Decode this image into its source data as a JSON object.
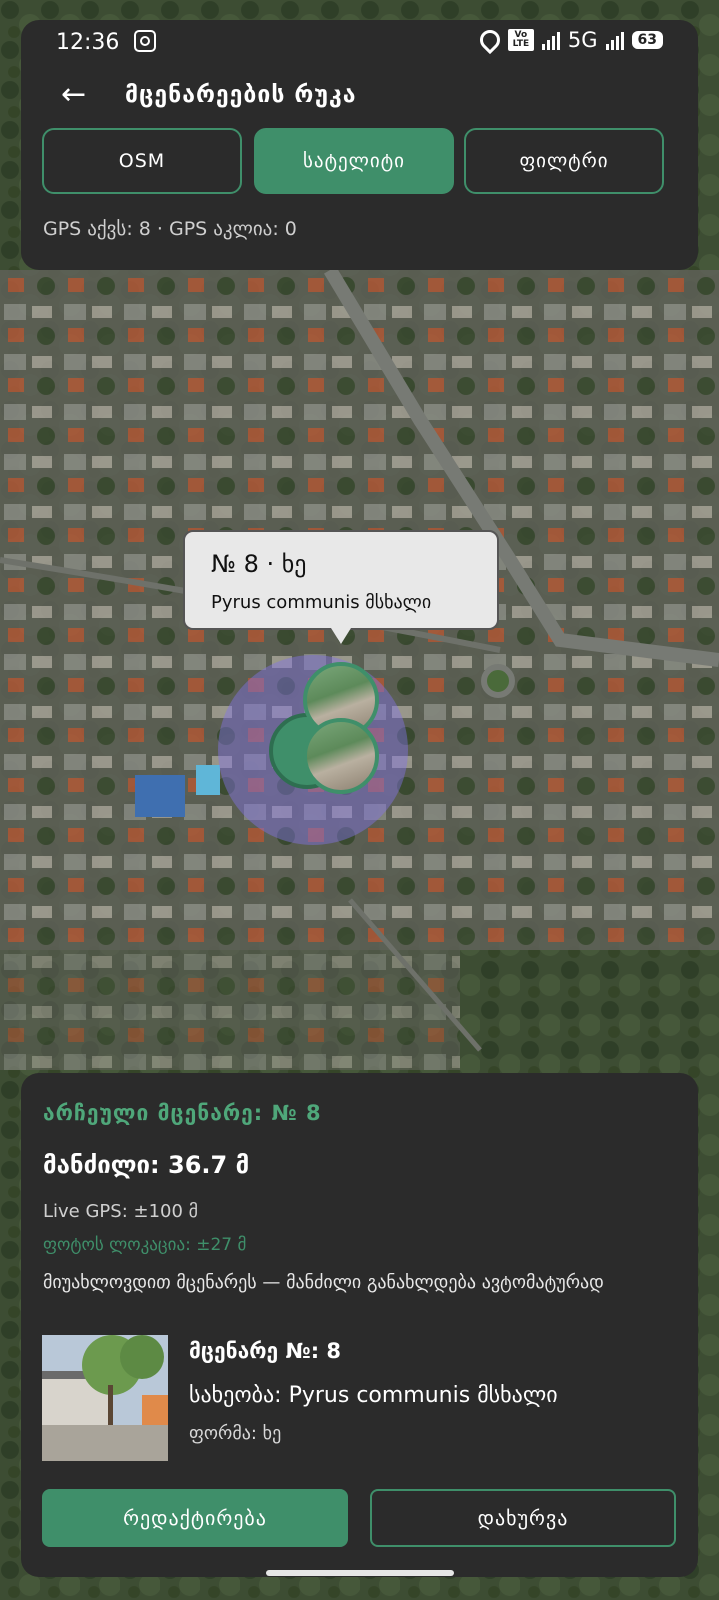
{
  "status_bar": {
    "time": "12:36",
    "network": "5G",
    "volte": "Vo LTE",
    "battery": "63"
  },
  "header": {
    "title": "მცენარეების რუკა",
    "back_icon": "arrow-left-icon"
  },
  "tabs": [
    {
      "label": "OSM",
      "active": false
    },
    {
      "label": "სატელიტი",
      "active": true
    },
    {
      "label": "ფილტრი",
      "active": false
    }
  ],
  "gps_summary": "GPS აქვს: 8 · GPS აკლია: 0",
  "callout": {
    "title": "№ 8 · ხე",
    "subtitle": "Pyrus communis მსხალი"
  },
  "selected": {
    "heading": "არჩეული მცენარე: № 8",
    "distance": "მანძილი: 36.7 მ",
    "live_gps": "Live GPS: ±100 მ",
    "photo_location": "ფოტოს ლოკაცია: ±27 მ",
    "hint": "მიუახლოვდით მცენარეს — მანძილი განახლდება ავტომატურად",
    "plant_number": "მცენარე №: 8",
    "species": "სახეობა: Pyrus communis მსხალი",
    "form": "ფორმა: ხე"
  },
  "actions": {
    "edit": "რედაქტირება",
    "close": "დახურვა"
  },
  "colors": {
    "accent": "#3f8f6a",
    "panel": "#2b2b2b",
    "accuracy_circle": "#8273e6"
  }
}
